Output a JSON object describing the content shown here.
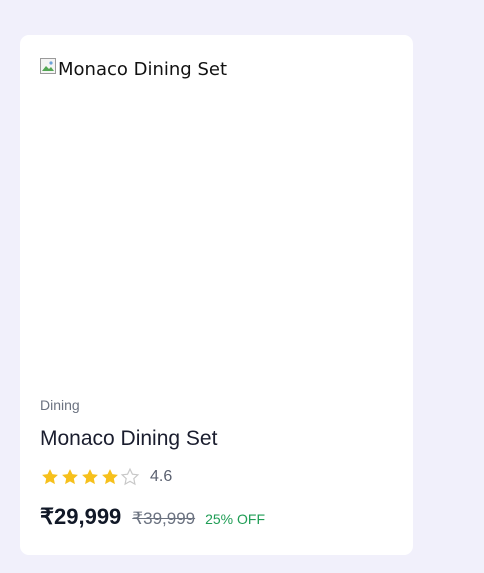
{
  "product": {
    "image_alt": "Monaco Dining Set",
    "category": "Dining",
    "title": "Monaco Dining Set",
    "rating": 4.6,
    "rating_text": "4.6",
    "stars_filled": 4,
    "stars_total": 5,
    "price": "₹29,999",
    "original_price": "₹39,999",
    "discount": "25% OFF"
  },
  "colors": {
    "page_background": "#f1f0fb",
    "card_background": "#ffffff",
    "star_filled": "#f6c01c",
    "star_empty_outline": "#c8c8c8",
    "discount_text": "#1f9d55"
  },
  "icons": {
    "broken_image": "broken-image-icon",
    "star": "star-icon"
  }
}
